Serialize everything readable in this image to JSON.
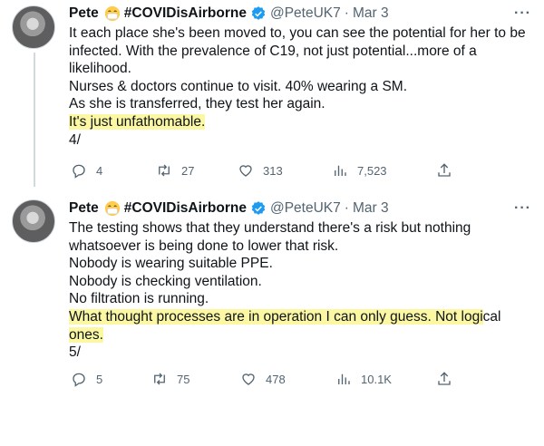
{
  "tweets": [
    {
      "author_name": "Pete",
      "author_tag": "#COVIDisAirborne",
      "handle": "@PeteUK7",
      "separator": "·",
      "date": "Mar 3",
      "more": "···",
      "lines": [
        "It each place she's been moved to, you can see the potential for her to be",
        "infected. With the prevalence of C19, not just potential...more of a",
        "likelihood.",
        "Nurses & doctors continue to visit. 40% wearing a SM.",
        "As she is transferred, they test her again.",
        "It's just unfathomable.",
        "4/"
      ],
      "replies": "4",
      "retweets": "27",
      "likes": "313",
      "views": "7,523"
    },
    {
      "author_name": "Pete",
      "author_tag": "#COVIDisAirborne",
      "handle": "@PeteUK7",
      "separator": "·",
      "date": "Mar 3",
      "more": "···",
      "lines": [
        "The testing shows that they understand there's a risk but nothing",
        "whatsoever is being done to lower that risk.",
        "Nobody is wearing suitable PPE.",
        "Nobody is checking ventilation.",
        "No filtration is running.",
        "What thought processes are in operation I can only guess. Not logi",
        "cal",
        "ones.",
        "5/"
      ],
      "replies": "5",
      "retweets": "75",
      "likes": "478",
      "views": "10.1K"
    }
  ],
  "colors": {
    "highlight": "#fbf7a3",
    "muted": "#536471",
    "verified": "#1d9bf0"
  },
  "icons": [
    "reply-icon",
    "retweet-icon",
    "like-icon",
    "views-icon",
    "share-icon",
    "verified-icon",
    "mask-emoji-icon"
  ]
}
